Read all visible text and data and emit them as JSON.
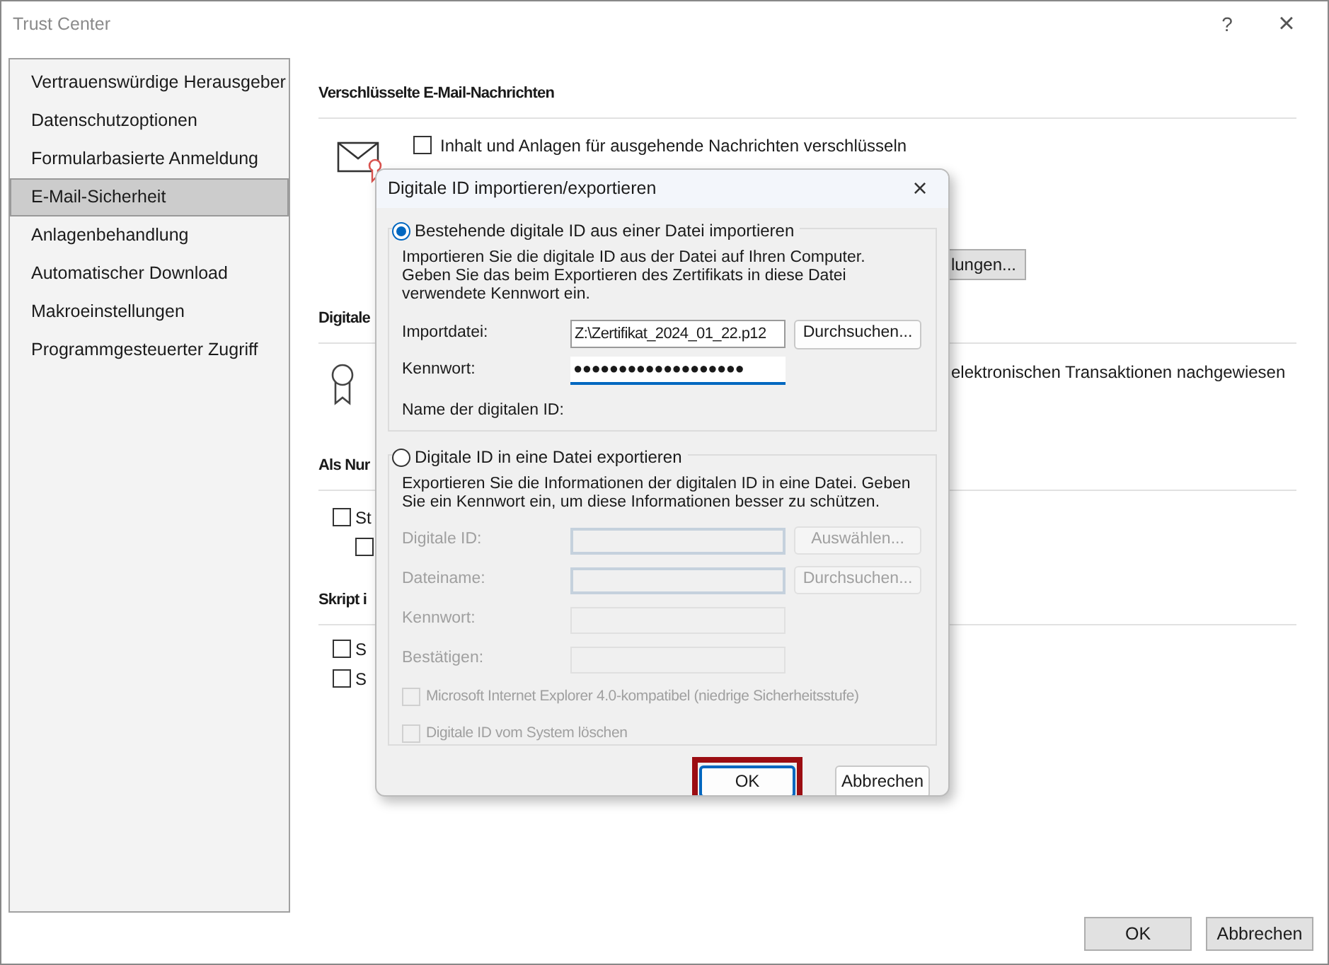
{
  "window": {
    "title": "Trust Center",
    "help": "?",
    "close": "×"
  },
  "sidebar": {
    "items": [
      {
        "label": "Vertrauenswürdige Herausgeber",
        "selected": false
      },
      {
        "label": "Datenschutzoptionen",
        "selected": false
      },
      {
        "label": "Formularbasierte Anmeldung",
        "selected": false
      },
      {
        "label": "E-Mail-Sicherheit",
        "selected": true
      },
      {
        "label": "Anlagenbehandlung",
        "selected": false
      },
      {
        "label": "Automatischer Download",
        "selected": false
      },
      {
        "label": "Makroeinstellungen",
        "selected": false
      },
      {
        "label": "Programmgesteuerter Zugriff",
        "selected": false
      }
    ]
  },
  "encrypted_mail": {
    "heading": "Verschlüsselte E-Mail-Nachrichten",
    "options": [
      {
        "label": "Inhalt und Anlagen für ausgehende Nachrichten verschlüsseln",
        "checked": false
      }
    ],
    "settings_button": "lungen..."
  },
  "digital_ids": {
    "heading": "Digitale",
    "text": "elektronischen Transaktionen nachgewiesen"
  },
  "plain_text": {
    "heading": "Als Nur",
    "options": [
      {
        "label": "St",
        "checked": false
      },
      {
        "checked": false
      }
    ]
  },
  "script": {
    "heading": "Skript i",
    "options": [
      {
        "label": "S",
        "checked": false
      },
      {
        "label": "S",
        "checked": false
      }
    ]
  },
  "footer_buttons": [
    {
      "label": "OK"
    },
    {
      "label": "Abbrechen"
    }
  ],
  "dialog": {
    "title": "Digitale ID importieren/exportieren",
    "close": "×",
    "import": {
      "selected": true,
      "label": "Bestehende digitale ID aus einer Datei importieren",
      "description": "Importieren Sie die digitale ID aus der Datei auf Ihren Computer. Geben Sie das beim Exportieren des Zertifikats in diese Datei verwendete Kennwort ein.",
      "fields": [
        {
          "label": "Importdatei:",
          "value": "Z:\\Zertifikat_2024_01_22.p12",
          "button": "Durchsuchen...",
          "focused": false
        },
        {
          "label": "Kennwort:",
          "value": "●●●●●●●●●●●●●●●●●●●",
          "focused": true
        }
      ],
      "name_label": "Name der digitalen ID:"
    },
    "export": {
      "selected": false,
      "disabled": true,
      "label": "Digitale ID in eine Datei exportieren",
      "description": "Exportieren Sie die Informationen der digitalen ID in eine Datei. Geben Sie ein Kennwort ein, um diese Informationen besser zu schützen.",
      "fields": [
        {
          "label": "Digitale ID:",
          "button": "Auswählen...",
          "kind": "framed"
        },
        {
          "label": "Dateiname:",
          "button": "Durchsuchen...",
          "kind": "framed"
        },
        {
          "label": "Kennwort:",
          "kind": "plain"
        },
        {
          "label": "Bestätigen:",
          "kind": "plain"
        }
      ],
      "options": [
        {
          "label": "Microsoft Internet Explorer 4.0-kompatibel (niedrige Sicherheitsstufe)",
          "checked": false
        },
        {
          "label": "Digitale ID vom System löschen",
          "checked": false
        }
      ]
    },
    "buttons": [
      {
        "label": "OK",
        "highlighted": true
      },
      {
        "label": "Abbrechen",
        "highlighted": false
      }
    ]
  }
}
